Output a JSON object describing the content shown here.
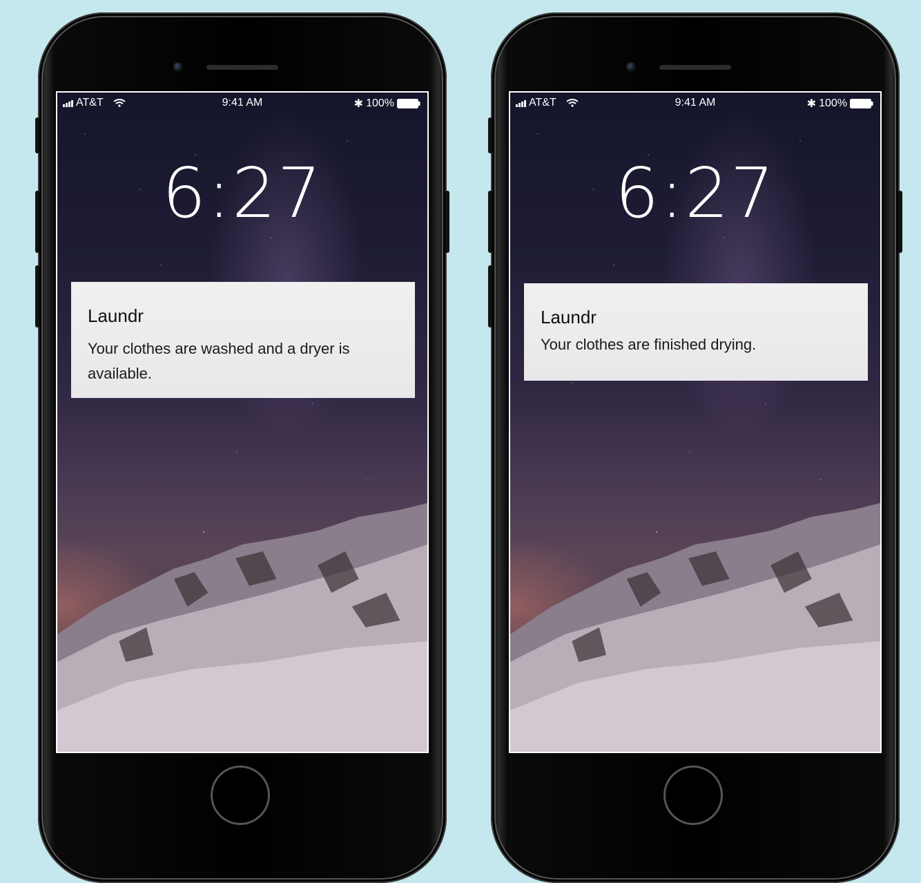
{
  "phones": [
    {
      "status": {
        "carrier": "AT&T",
        "time": "9:41 AM",
        "battery": "100%"
      },
      "clock": "6:27",
      "notification": {
        "app_name": "Laundr",
        "message": "Your clothes are washed and a dryer is available."
      }
    },
    {
      "status": {
        "carrier": "AT&T",
        "time": "9:41 AM",
        "battery": "100%"
      },
      "clock": "6:27",
      "notification": {
        "app_name": "Laundr",
        "message": "Your clothes are finished drying."
      }
    }
  ],
  "colors": {
    "background": "#c5e8ee",
    "notification_bg": "#ececee",
    "phone_body": "#000000"
  }
}
